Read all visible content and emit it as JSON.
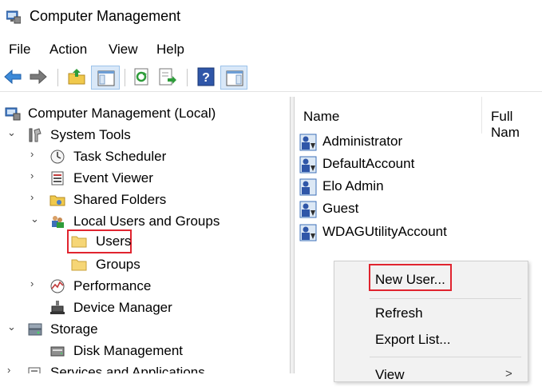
{
  "window": {
    "title": "Computer Management"
  },
  "menubar": {
    "items": [
      "File",
      "Action",
      "View",
      "Help"
    ]
  },
  "toolbar": {
    "buttons": [
      "back-icon",
      "forward-icon",
      "up-folder-icon",
      "show-hide-tree-icon",
      "refresh-icon",
      "export-list-icon",
      "help-icon",
      "show-hide-action-pane-icon"
    ]
  },
  "tree": {
    "root": "Computer Management (Local)",
    "system_tools": "System Tools",
    "task_scheduler": "Task Scheduler",
    "event_viewer": "Event Viewer",
    "shared_folders": "Shared Folders",
    "local_users_groups": "Local Users and Groups",
    "users": "Users",
    "groups": "Groups",
    "performance": "Performance",
    "device_manager": "Device Manager",
    "storage": "Storage",
    "disk_management": "Disk Management",
    "services_apps": "Services and Applications"
  },
  "list": {
    "columns": [
      "Name",
      "Full Nam"
    ],
    "rows": [
      "Administrator",
      "DefaultAccount",
      "Elo Admin",
      "Guest",
      "WDAGUtilityAccount"
    ]
  },
  "context_menu": {
    "items": [
      "New User...",
      "Refresh",
      "Export List...",
      "View"
    ],
    "submenu_arrow": ">"
  },
  "colors": {
    "highlight_border": "#e0242f",
    "folder_yellow": "#f6d676"
  }
}
